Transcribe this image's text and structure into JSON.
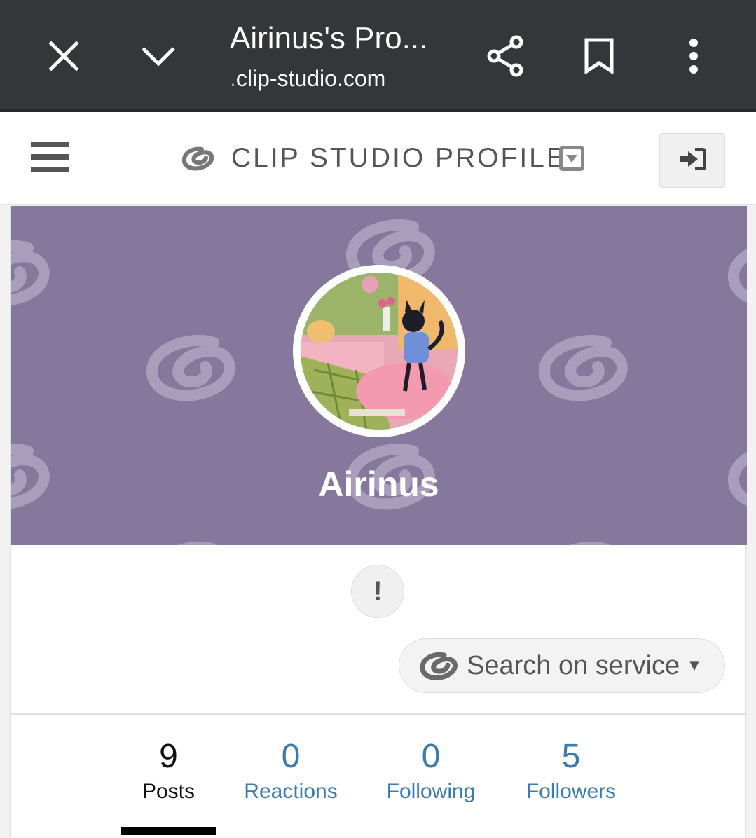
{
  "browser": {
    "title": "Airinus's Pro...",
    "url_prefix": ".",
    "url": "clip-studio.com",
    "icons": [
      "close-icon",
      "chevron-down-icon",
      "share-icon",
      "bookmark-icon",
      "more-vert-icon"
    ]
  },
  "header": {
    "brand": "CLIP STUDIO PROFILE",
    "menu_icon": "hamburger-icon",
    "login_icon": "sign-in-icon"
  },
  "profile": {
    "username": "Airinus",
    "report_label": "!",
    "search_service_label": "Search on service",
    "banner_color": "#86779d"
  },
  "stats": [
    {
      "value": "9",
      "label": "Posts",
      "active": true
    },
    {
      "value": "0",
      "label": "Reactions",
      "active": false
    },
    {
      "value": "0",
      "label": "Following",
      "active": false
    },
    {
      "value": "5",
      "label": "Followers",
      "active": false
    }
  ],
  "colors": {
    "browser_bar": "#35363a",
    "link": "#3b7bb0",
    "active_underline": "#000000"
  }
}
